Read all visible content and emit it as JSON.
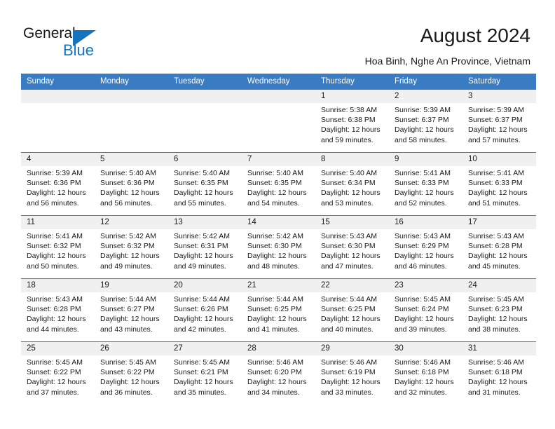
{
  "brand": {
    "name_part1": "General",
    "name_part2": "Blue",
    "accent_color": "#1673bd",
    "triangle_icon": "triangle-icon"
  },
  "header": {
    "title": "August 2024",
    "subtitle": "Hoa Binh, Nghe An Province, Vietnam"
  },
  "calendar": {
    "header_color": "#3a7cc4",
    "weekday_headers": [
      "Sunday",
      "Monday",
      "Tuesday",
      "Wednesday",
      "Thursday",
      "Friday",
      "Saturday"
    ],
    "weeks": [
      [
        {
          "day": "",
          "sunrise": "",
          "sunset": "",
          "daylight_line1": "",
          "daylight_line2": "",
          "empty": true
        },
        {
          "day": "",
          "sunrise": "",
          "sunset": "",
          "daylight_line1": "",
          "daylight_line2": "",
          "empty": true
        },
        {
          "day": "",
          "sunrise": "",
          "sunset": "",
          "daylight_line1": "",
          "daylight_line2": "",
          "empty": true
        },
        {
          "day": "",
          "sunrise": "",
          "sunset": "",
          "daylight_line1": "",
          "daylight_line2": "",
          "empty": true
        },
        {
          "day": "1",
          "sunrise": "Sunrise: 5:38 AM",
          "sunset": "Sunset: 6:38 PM",
          "daylight_line1": "Daylight: 12 hours",
          "daylight_line2": "and 59 minutes."
        },
        {
          "day": "2",
          "sunrise": "Sunrise: 5:39 AM",
          "sunset": "Sunset: 6:37 PM",
          "daylight_line1": "Daylight: 12 hours",
          "daylight_line2": "and 58 minutes."
        },
        {
          "day": "3",
          "sunrise": "Sunrise: 5:39 AM",
          "sunset": "Sunset: 6:37 PM",
          "daylight_line1": "Daylight: 12 hours",
          "daylight_line2": "and 57 minutes."
        }
      ],
      [
        {
          "day": "4",
          "sunrise": "Sunrise: 5:39 AM",
          "sunset": "Sunset: 6:36 PM",
          "daylight_line1": "Daylight: 12 hours",
          "daylight_line2": "and 56 minutes."
        },
        {
          "day": "5",
          "sunrise": "Sunrise: 5:40 AM",
          "sunset": "Sunset: 6:36 PM",
          "daylight_line1": "Daylight: 12 hours",
          "daylight_line2": "and 56 minutes."
        },
        {
          "day": "6",
          "sunrise": "Sunrise: 5:40 AM",
          "sunset": "Sunset: 6:35 PM",
          "daylight_line1": "Daylight: 12 hours",
          "daylight_line2": "and 55 minutes."
        },
        {
          "day": "7",
          "sunrise": "Sunrise: 5:40 AM",
          "sunset": "Sunset: 6:35 PM",
          "daylight_line1": "Daylight: 12 hours",
          "daylight_line2": "and 54 minutes."
        },
        {
          "day": "8",
          "sunrise": "Sunrise: 5:40 AM",
          "sunset": "Sunset: 6:34 PM",
          "daylight_line1": "Daylight: 12 hours",
          "daylight_line2": "and 53 minutes."
        },
        {
          "day": "9",
          "sunrise": "Sunrise: 5:41 AM",
          "sunset": "Sunset: 6:33 PM",
          "daylight_line1": "Daylight: 12 hours",
          "daylight_line2": "and 52 minutes."
        },
        {
          "day": "10",
          "sunrise": "Sunrise: 5:41 AM",
          "sunset": "Sunset: 6:33 PM",
          "daylight_line1": "Daylight: 12 hours",
          "daylight_line2": "and 51 minutes."
        }
      ],
      [
        {
          "day": "11",
          "sunrise": "Sunrise: 5:41 AM",
          "sunset": "Sunset: 6:32 PM",
          "daylight_line1": "Daylight: 12 hours",
          "daylight_line2": "and 50 minutes."
        },
        {
          "day": "12",
          "sunrise": "Sunrise: 5:42 AM",
          "sunset": "Sunset: 6:32 PM",
          "daylight_line1": "Daylight: 12 hours",
          "daylight_line2": "and 49 minutes."
        },
        {
          "day": "13",
          "sunrise": "Sunrise: 5:42 AM",
          "sunset": "Sunset: 6:31 PM",
          "daylight_line1": "Daylight: 12 hours",
          "daylight_line2": "and 49 minutes."
        },
        {
          "day": "14",
          "sunrise": "Sunrise: 5:42 AM",
          "sunset": "Sunset: 6:30 PM",
          "daylight_line1": "Daylight: 12 hours",
          "daylight_line2": "and 48 minutes."
        },
        {
          "day": "15",
          "sunrise": "Sunrise: 5:43 AM",
          "sunset": "Sunset: 6:30 PM",
          "daylight_line1": "Daylight: 12 hours",
          "daylight_line2": "and 47 minutes."
        },
        {
          "day": "16",
          "sunrise": "Sunrise: 5:43 AM",
          "sunset": "Sunset: 6:29 PM",
          "daylight_line1": "Daylight: 12 hours",
          "daylight_line2": "and 46 minutes."
        },
        {
          "day": "17",
          "sunrise": "Sunrise: 5:43 AM",
          "sunset": "Sunset: 6:28 PM",
          "daylight_line1": "Daylight: 12 hours",
          "daylight_line2": "and 45 minutes."
        }
      ],
      [
        {
          "day": "18",
          "sunrise": "Sunrise: 5:43 AM",
          "sunset": "Sunset: 6:28 PM",
          "daylight_line1": "Daylight: 12 hours",
          "daylight_line2": "and 44 minutes."
        },
        {
          "day": "19",
          "sunrise": "Sunrise: 5:44 AM",
          "sunset": "Sunset: 6:27 PM",
          "daylight_line1": "Daylight: 12 hours",
          "daylight_line2": "and 43 minutes."
        },
        {
          "day": "20",
          "sunrise": "Sunrise: 5:44 AM",
          "sunset": "Sunset: 6:26 PM",
          "daylight_line1": "Daylight: 12 hours",
          "daylight_line2": "and 42 minutes."
        },
        {
          "day": "21",
          "sunrise": "Sunrise: 5:44 AM",
          "sunset": "Sunset: 6:25 PM",
          "daylight_line1": "Daylight: 12 hours",
          "daylight_line2": "and 41 minutes."
        },
        {
          "day": "22",
          "sunrise": "Sunrise: 5:44 AM",
          "sunset": "Sunset: 6:25 PM",
          "daylight_line1": "Daylight: 12 hours",
          "daylight_line2": "and 40 minutes."
        },
        {
          "day": "23",
          "sunrise": "Sunrise: 5:45 AM",
          "sunset": "Sunset: 6:24 PM",
          "daylight_line1": "Daylight: 12 hours",
          "daylight_line2": "and 39 minutes."
        },
        {
          "day": "24",
          "sunrise": "Sunrise: 5:45 AM",
          "sunset": "Sunset: 6:23 PM",
          "daylight_line1": "Daylight: 12 hours",
          "daylight_line2": "and 38 minutes."
        }
      ],
      [
        {
          "day": "25",
          "sunrise": "Sunrise: 5:45 AM",
          "sunset": "Sunset: 6:22 PM",
          "daylight_line1": "Daylight: 12 hours",
          "daylight_line2": "and 37 minutes."
        },
        {
          "day": "26",
          "sunrise": "Sunrise: 5:45 AM",
          "sunset": "Sunset: 6:22 PM",
          "daylight_line1": "Daylight: 12 hours",
          "daylight_line2": "and 36 minutes."
        },
        {
          "day": "27",
          "sunrise": "Sunrise: 5:45 AM",
          "sunset": "Sunset: 6:21 PM",
          "daylight_line1": "Daylight: 12 hours",
          "daylight_line2": "and 35 minutes."
        },
        {
          "day": "28",
          "sunrise": "Sunrise: 5:46 AM",
          "sunset": "Sunset: 6:20 PM",
          "daylight_line1": "Daylight: 12 hours",
          "daylight_line2": "and 34 minutes."
        },
        {
          "day": "29",
          "sunrise": "Sunrise: 5:46 AM",
          "sunset": "Sunset: 6:19 PM",
          "daylight_line1": "Daylight: 12 hours",
          "daylight_line2": "and 33 minutes."
        },
        {
          "day": "30",
          "sunrise": "Sunrise: 5:46 AM",
          "sunset": "Sunset: 6:18 PM",
          "daylight_line1": "Daylight: 12 hours",
          "daylight_line2": "and 32 minutes."
        },
        {
          "day": "31",
          "sunrise": "Sunrise: 5:46 AM",
          "sunset": "Sunset: 6:18 PM",
          "daylight_line1": "Daylight: 12 hours",
          "daylight_line2": "and 31 minutes."
        }
      ]
    ]
  }
}
